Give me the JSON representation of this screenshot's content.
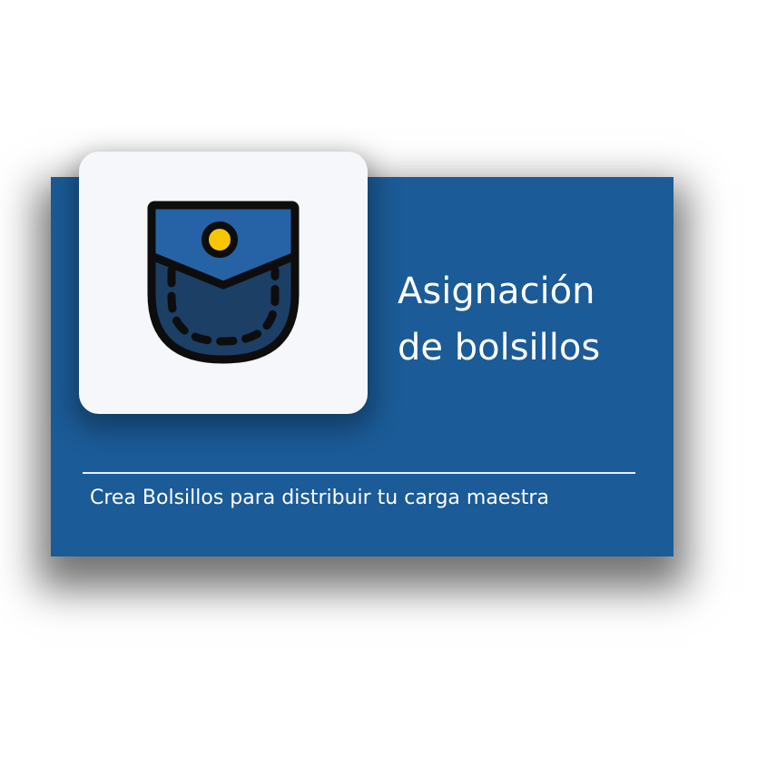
{
  "card": {
    "title_line1": "Asignación",
    "title_line2": "de bolsillos",
    "subtitle": "Crea Bolsillos para distribuir tu carga maestra"
  },
  "icon": {
    "name": "pocket-icon",
    "colors": {
      "pocket_flap": "#2563a6",
      "pocket_body": "#1c3f66",
      "button": "#f7c600",
      "outline": "#0d0d0d"
    }
  },
  "colors": {
    "card_background": "#1b5b97",
    "tile_background": "#f5f7fa",
    "text": "#ffffff"
  }
}
